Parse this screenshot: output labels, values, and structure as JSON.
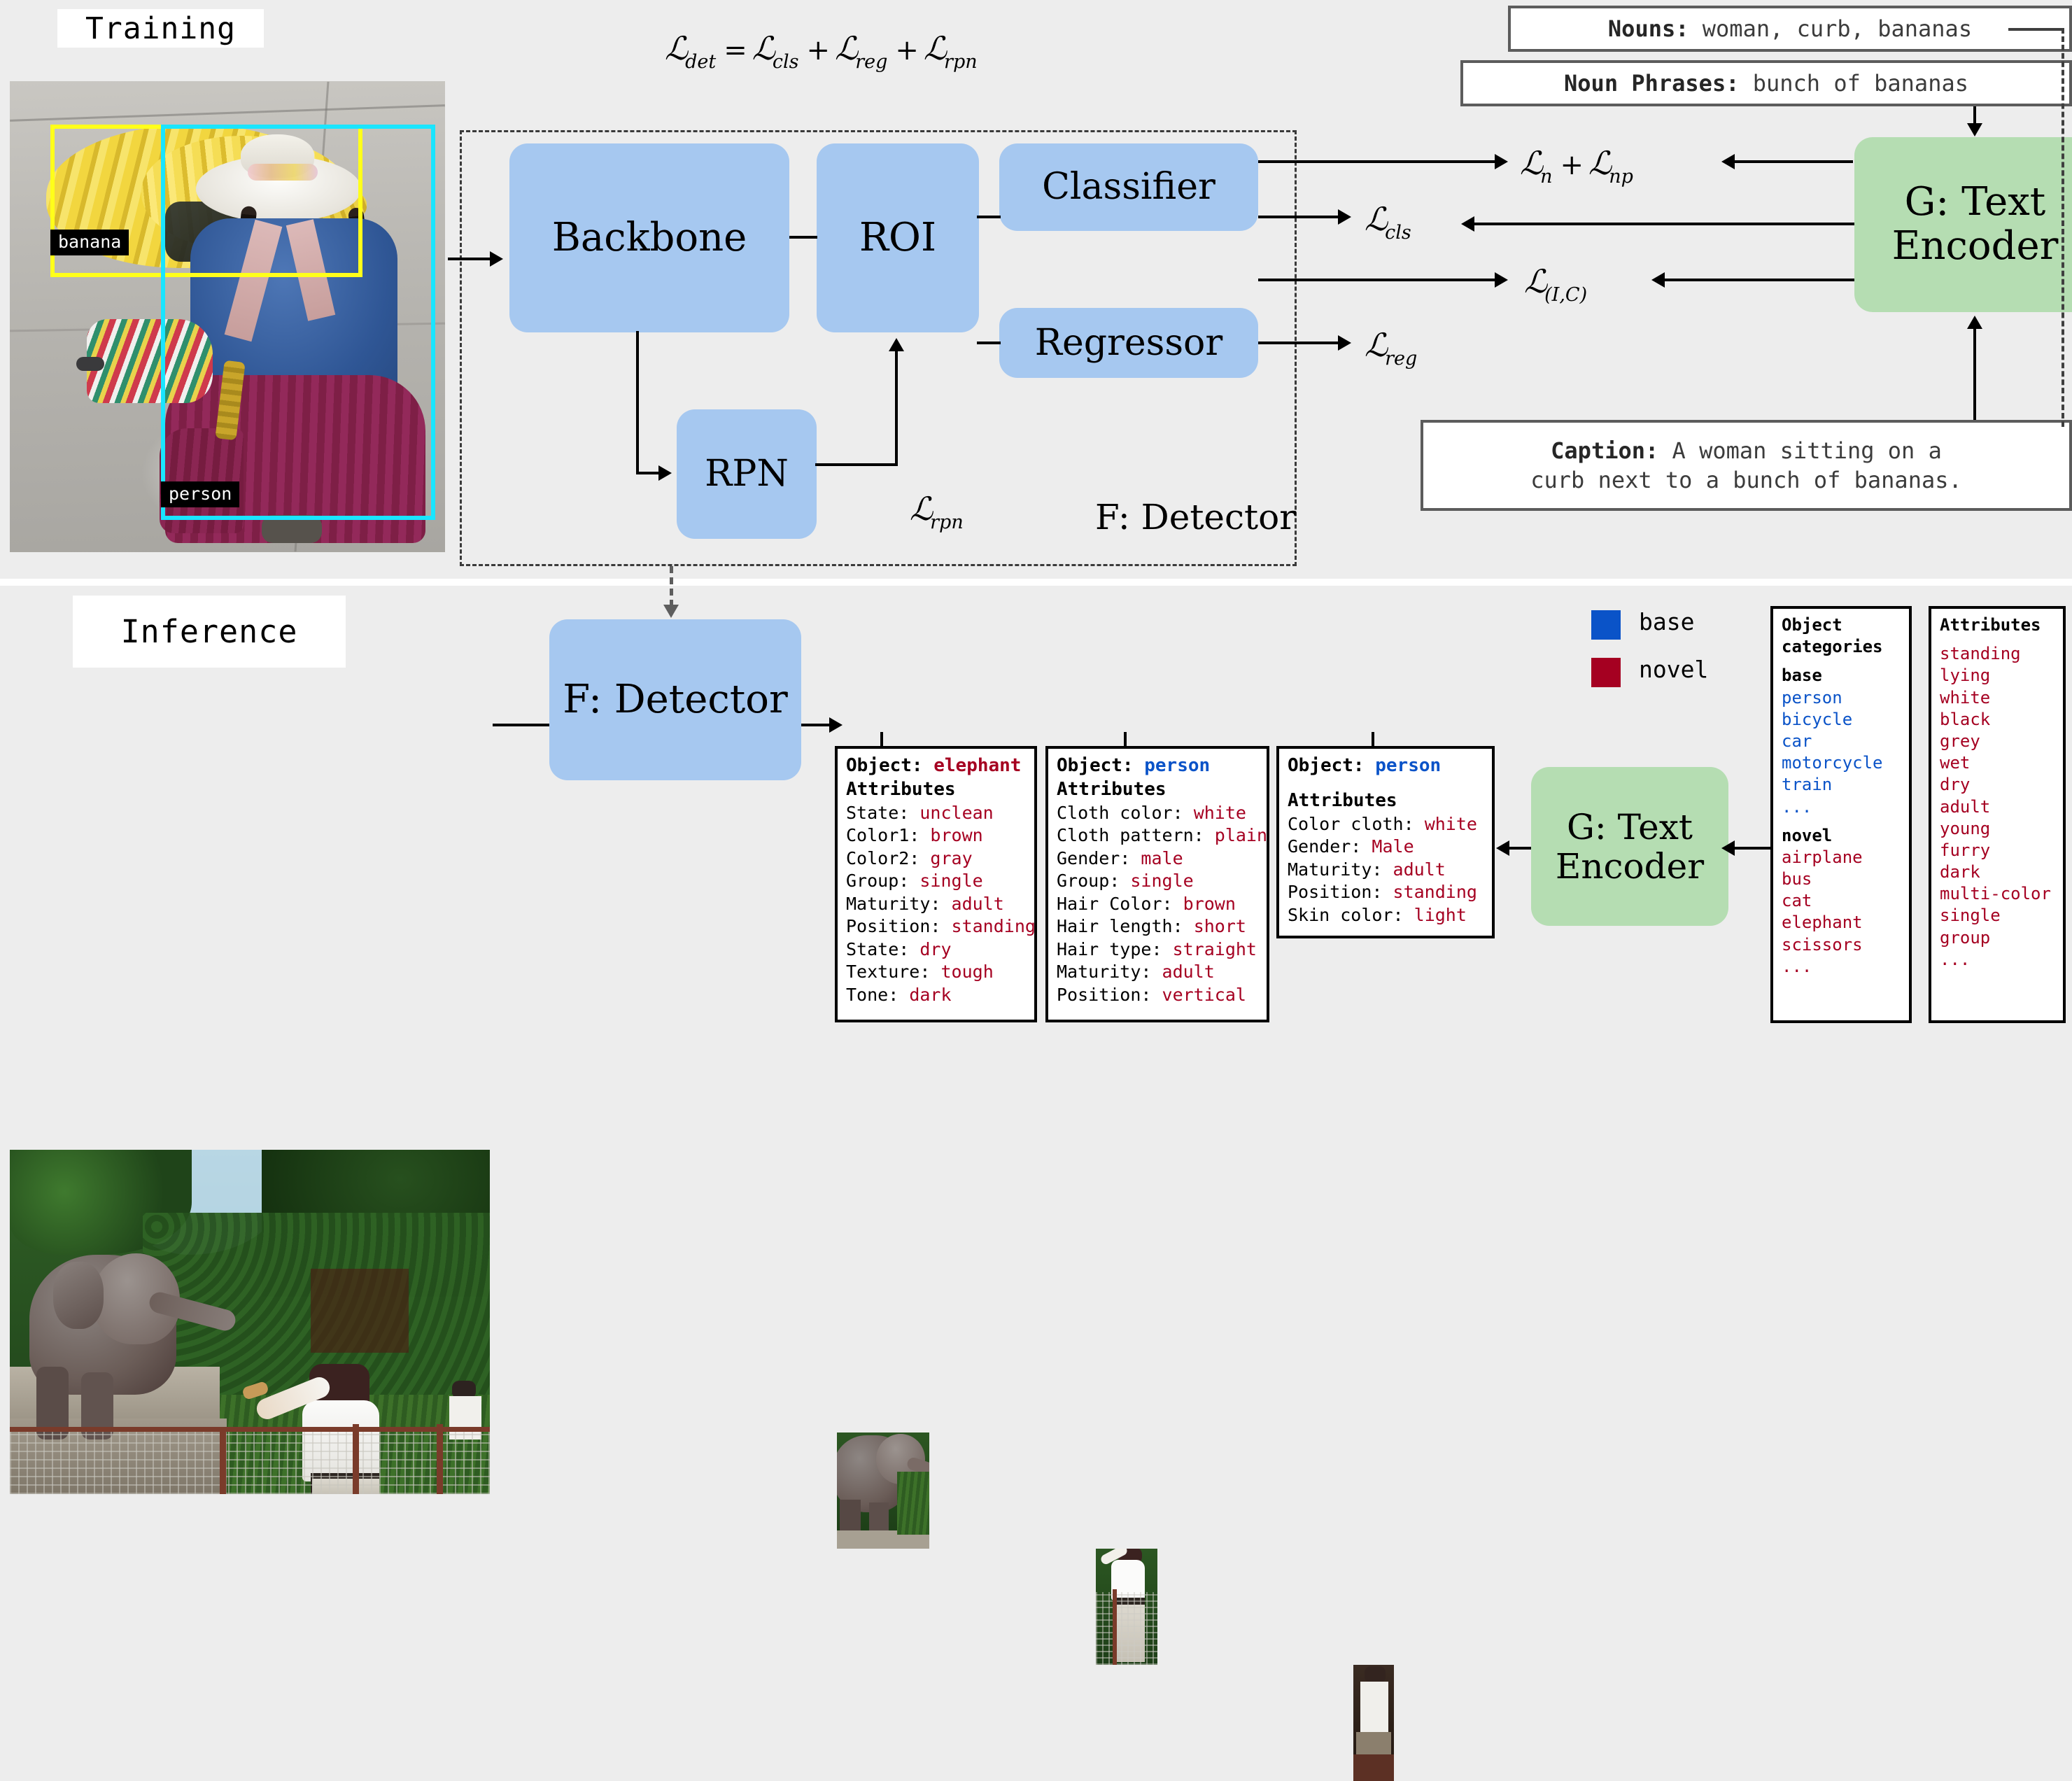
{
  "sections": {
    "training_label": "Training",
    "inference_label": "Inference"
  },
  "equation": {
    "det": "L",
    "det_sub": "det",
    "eq": "=",
    "cls": "L",
    "cls_sub": "cls",
    "plus1": "+",
    "reg": "L",
    "reg_sub": "reg",
    "plus2": "+",
    "rpn": "L",
    "rpn_sub": "rpn"
  },
  "training_image": {
    "boxes": [
      {
        "label": "banana",
        "color": "#ffff1a"
      },
      {
        "label": "person",
        "color": "#1ae5ff"
      }
    ]
  },
  "detector": {
    "frame_label": "F: Detector",
    "backbone": "Backbone",
    "roi": "ROI",
    "classifier": "Classifier",
    "regressor": "Regressor",
    "rpn": "RPN",
    "rpn_loss": "L",
    "rpn_loss_sub": "rpn"
  },
  "losses": {
    "n_np": {
      "a": "L",
      "a_sub": "n",
      "op": "+",
      "b": "L",
      "b_sub": "np"
    },
    "cls": {
      "a": "L",
      "a_sub": "cls"
    },
    "ic": {
      "a": "L",
      "a_sub": "(I,C)"
    },
    "reg": {
      "a": "L",
      "a_sub": "reg"
    }
  },
  "text_encoder": {
    "line1": "G: Text",
    "line2": "Encoder"
  },
  "text_inputs": {
    "nouns_key": "Nouns:",
    "nouns_val": "woman, curb, bananas",
    "noun_phrases_key": "Noun Phrases:",
    "noun_phrases_val": "bunch of bananas",
    "caption_key": "Caption:",
    "caption_line1": "A woman sitting on a",
    "caption_line2": "curb next to a bunch of bananas."
  },
  "inference": {
    "detector_label": "F: Detector",
    "text_encoder_line1": "G: Text",
    "text_encoder_line2": "Encoder"
  },
  "predictions": [
    {
      "object_key": "Object:",
      "object_value": "elephant",
      "object_type": "novel",
      "attributes_header": "Attributes",
      "rows": [
        {
          "key": "State:",
          "value": "unclean"
        },
        {
          "key": "Color1:",
          "value": "brown"
        },
        {
          "key": "Color2:",
          "value": "gray"
        },
        {
          "key": "Group:",
          "value": "single"
        },
        {
          "key": "Maturity:",
          "value": "adult"
        },
        {
          "key": "Position:",
          "value": "standing"
        },
        {
          "key": "State:",
          "value": "dry"
        },
        {
          "key": "Texture:",
          "value": "tough"
        },
        {
          "key": "Tone:",
          "value": "dark"
        }
      ]
    },
    {
      "object_key": "Object:",
      "object_value": "person",
      "object_type": "base",
      "attributes_header": "Attributes",
      "rows": [
        {
          "key": "Cloth color:",
          "value": "white"
        },
        {
          "key": "Cloth pattern:",
          "value": "plain"
        },
        {
          "key": "Gender:",
          "value": "male"
        },
        {
          "key": "Group:",
          "value": "single"
        },
        {
          "key": "Hair Color:",
          "value": "brown"
        },
        {
          "key": "Hair length:",
          "value": "short"
        },
        {
          "key": "Hair type:",
          "value": "straight"
        },
        {
          "key": "Maturity:",
          "value": "adult"
        },
        {
          "key": "Position:",
          "value": "vertical"
        }
      ]
    },
    {
      "object_key": "Object:",
      "object_value": "person",
      "object_type": "base",
      "attributes_header": "Attributes",
      "rows": [
        {
          "key": "Color cloth:",
          "value": "white"
        },
        {
          "key": "Gender:",
          "value": "Male"
        },
        {
          "key": "Maturity:",
          "value": "adult"
        },
        {
          "key": "Position:",
          "value": "standing"
        },
        {
          "key": "Skin color:",
          "value": "light"
        }
      ]
    }
  ],
  "legend": {
    "base_label": "base",
    "novel_label": "novel",
    "base_color": "#0a53c8",
    "novel_color": "#a50021"
  },
  "object_categories": {
    "title_line1": "Object",
    "title_line2": "categories",
    "base_header": "base",
    "base_items": [
      "person",
      "bicycle",
      "car",
      "motorcycle",
      "train",
      "..."
    ],
    "novel_header": "novel",
    "novel_items": [
      "airplane",
      "bus",
      "cat",
      "elephant",
      "scissors",
      "..."
    ]
  },
  "attributes_vocab": {
    "title": "Attributes",
    "items": [
      "standing",
      "lying",
      "white",
      "black",
      "grey",
      "wet",
      "dry",
      "adult",
      "young",
      "furry",
      "dark",
      "multi-color",
      "single",
      "group",
      "..."
    ]
  }
}
